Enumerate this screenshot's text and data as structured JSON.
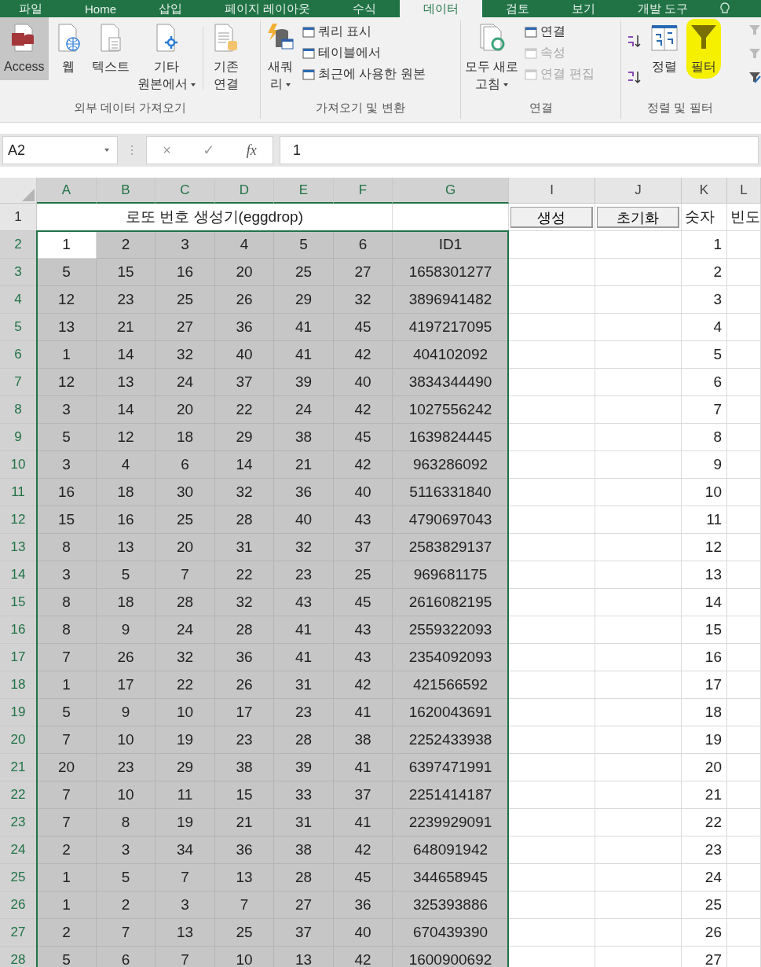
{
  "ribbon_tabs": [
    {
      "label": "파일",
      "selected": false
    },
    {
      "label": "Home",
      "selected": false
    },
    {
      "label": "삽입",
      "selected": false
    },
    {
      "label": "페이지 레이아웃",
      "selected": false
    },
    {
      "label": "수식",
      "selected": false
    },
    {
      "label": "데이터",
      "selected": true
    },
    {
      "label": "검토",
      "selected": false
    },
    {
      "label": "보기",
      "selected": false
    },
    {
      "label": "개발 도구",
      "selected": false
    }
  ],
  "ribbon_groups": [
    {
      "label": "외부 데이터 가져오기",
      "large": [
        {
          "lines": [
            "Access"
          ],
          "dropdown": false,
          "selected": true
        },
        {
          "lines": [
            "웹"
          ],
          "dropdown": false,
          "selected": false
        },
        {
          "lines": [
            "텍스트"
          ],
          "dropdown": false,
          "selected": false
        },
        {
          "lines": [
            "기타",
            "원본에서"
          ],
          "dropdown": true,
          "selected": false
        },
        {
          "lines": [
            "기존",
            "연결"
          ],
          "dropdown": false,
          "selected": false
        }
      ]
    },
    {
      "label": "가져오기 및 변환",
      "large": [
        {
          "lines": [
            "새쿼",
            "리"
          ],
          "dropdown": true,
          "selected": false
        }
      ],
      "small": [
        {
          "label": "쿼리 표시",
          "disabled": false
        },
        {
          "label": "테이블에서",
          "disabled": false
        },
        {
          "label": "최근에 사용한 원본",
          "disabled": false
        }
      ]
    },
    {
      "label": "연결",
      "large": [
        {
          "lines": [
            "모두 새로",
            "고침"
          ],
          "dropdown": true,
          "selected": false
        }
      ],
      "small": [
        {
          "label": "연결",
          "disabled": false
        },
        {
          "label": "속성",
          "disabled": true
        },
        {
          "label": "연결 편집",
          "disabled": true
        }
      ]
    },
    {
      "label": "정렬 및 필터",
      "large": [
        {
          "lines": [
            "정렬"
          ],
          "dropdown": false,
          "selected": false
        },
        {
          "lines": [
            "필터"
          ],
          "dropdown": false,
          "selected": false
        }
      ]
    }
  ],
  "formula_bar": {
    "name_box": "A2",
    "cancel": "×",
    "enter": "✓",
    "fx": "fx",
    "value": "1"
  },
  "columns": [
    {
      "label": "A",
      "selected": true
    },
    {
      "label": "B",
      "selected": true
    },
    {
      "label": "C",
      "selected": true
    },
    {
      "label": "D",
      "selected": true
    },
    {
      "label": "E",
      "selected": true
    },
    {
      "label": "F",
      "selected": true
    },
    {
      "label": "G",
      "selected": true
    },
    {
      "label": "I",
      "selected": false
    },
    {
      "label": "J",
      "selected": false
    },
    {
      "label": "K",
      "selected": false
    },
    {
      "label": "L",
      "selected": false
    }
  ],
  "header_row": {
    "num": "1",
    "title": "로또 번호 생성기(eggdrop)",
    "buttons": [
      "생성",
      "초기화"
    ],
    "k": "숫자",
    "l": "빈도"
  },
  "rows": [
    {
      "num": "2",
      "selected": true,
      "active": true,
      "cells": [
        "1",
        "2",
        "3",
        "4",
        "5",
        "6",
        "ID1"
      ],
      "k": "1"
    },
    {
      "num": "3",
      "selected": true,
      "active": false,
      "cells": [
        "5",
        "15",
        "16",
        "20",
        "25",
        "27",
        "1658301277"
      ],
      "k": "2"
    },
    {
      "num": "4",
      "selected": true,
      "active": false,
      "cells": [
        "12",
        "23",
        "25",
        "26",
        "29",
        "32",
        "3896941482"
      ],
      "k": "3"
    },
    {
      "num": "5",
      "selected": true,
      "active": false,
      "cells": [
        "13",
        "21",
        "27",
        "36",
        "41",
        "45",
        "4197217095"
      ],
      "k": "4"
    },
    {
      "num": "6",
      "selected": true,
      "active": false,
      "cells": [
        "1",
        "14",
        "32",
        "40",
        "41",
        "42",
        "404102092"
      ],
      "k": "5"
    },
    {
      "num": "7",
      "selected": true,
      "active": false,
      "cells": [
        "12",
        "13",
        "24",
        "37",
        "39",
        "40",
        "3834344490"
      ],
      "k": "6"
    },
    {
      "num": "8",
      "selected": true,
      "active": false,
      "cells": [
        "3",
        "14",
        "20",
        "22",
        "24",
        "42",
        "1027556242"
      ],
      "k": "7"
    },
    {
      "num": "9",
      "selected": true,
      "active": false,
      "cells": [
        "5",
        "12",
        "18",
        "29",
        "38",
        "45",
        "1639824445"
      ],
      "k": "8"
    },
    {
      "num": "10",
      "selected": true,
      "active": false,
      "cells": [
        "3",
        "4",
        "6",
        "14",
        "21",
        "42",
        "963286092"
      ],
      "k": "9"
    },
    {
      "num": "11",
      "selected": true,
      "active": false,
      "cells": [
        "16",
        "18",
        "30",
        "32",
        "36",
        "40",
        "5116331840"
      ],
      "k": "10"
    },
    {
      "num": "12",
      "selected": true,
      "active": false,
      "cells": [
        "15",
        "16",
        "25",
        "28",
        "40",
        "43",
        "4790697043"
      ],
      "k": "11"
    },
    {
      "num": "13",
      "selected": true,
      "active": false,
      "cells": [
        "8",
        "13",
        "20",
        "31",
        "32",
        "37",
        "2583829137"
      ],
      "k": "12"
    },
    {
      "num": "14",
      "selected": true,
      "active": false,
      "cells": [
        "3",
        "5",
        "7",
        "22",
        "23",
        "25",
        "969681175"
      ],
      "k": "13"
    },
    {
      "num": "15",
      "selected": true,
      "active": false,
      "cells": [
        "8",
        "18",
        "28",
        "32",
        "43",
        "45",
        "2616082195"
      ],
      "k": "14"
    },
    {
      "num": "16",
      "selected": true,
      "active": false,
      "cells": [
        "8",
        "9",
        "24",
        "28",
        "41",
        "43",
        "2559322093"
      ],
      "k": "15"
    },
    {
      "num": "17",
      "selected": true,
      "active": false,
      "cells": [
        "7",
        "26",
        "32",
        "36",
        "41",
        "43",
        "2354092093"
      ],
      "k": "16"
    },
    {
      "num": "18",
      "selected": true,
      "active": false,
      "cells": [
        "1",
        "17",
        "22",
        "26",
        "31",
        "42",
        "421566592"
      ],
      "k": "17"
    },
    {
      "num": "19",
      "selected": true,
      "active": false,
      "cells": [
        "5",
        "9",
        "10",
        "17",
        "23",
        "41",
        "1620043691"
      ],
      "k": "18"
    },
    {
      "num": "20",
      "selected": true,
      "active": false,
      "cells": [
        "7",
        "10",
        "19",
        "23",
        "28",
        "38",
        "2252433938"
      ],
      "k": "19"
    },
    {
      "num": "21",
      "selected": true,
      "active": false,
      "cells": [
        "20",
        "23",
        "29",
        "38",
        "39",
        "41",
        "6397471991"
      ],
      "k": "20"
    },
    {
      "num": "22",
      "selected": true,
      "active": false,
      "cells": [
        "7",
        "10",
        "11",
        "15",
        "33",
        "37",
        "2251414187"
      ],
      "k": "21"
    },
    {
      "num": "23",
      "selected": true,
      "active": false,
      "cells": [
        "7",
        "8",
        "19",
        "21",
        "31",
        "41",
        "2239929091"
      ],
      "k": "22"
    },
    {
      "num": "24",
      "selected": true,
      "active": false,
      "cells": [
        "2",
        "3",
        "34",
        "36",
        "38",
        "42",
        "648091942"
      ],
      "k": "23"
    },
    {
      "num": "25",
      "selected": true,
      "active": false,
      "cells": [
        "1",
        "5",
        "7",
        "13",
        "28",
        "45",
        "344658945"
      ],
      "k": "24"
    },
    {
      "num": "26",
      "selected": true,
      "active": false,
      "cells": [
        "1",
        "2",
        "3",
        "7",
        "27",
        "36",
        "325393886"
      ],
      "k": "25"
    },
    {
      "num": "27",
      "selected": true,
      "active": false,
      "cells": [
        "2",
        "7",
        "13",
        "25",
        "37",
        "40",
        "670439390"
      ],
      "k": "26"
    },
    {
      "num": "28",
      "selected": true,
      "active": false,
      "cells": [
        "5",
        "6",
        "7",
        "10",
        "13",
        "42",
        "1600900692"
      ],
      "k": "27"
    }
  ]
}
